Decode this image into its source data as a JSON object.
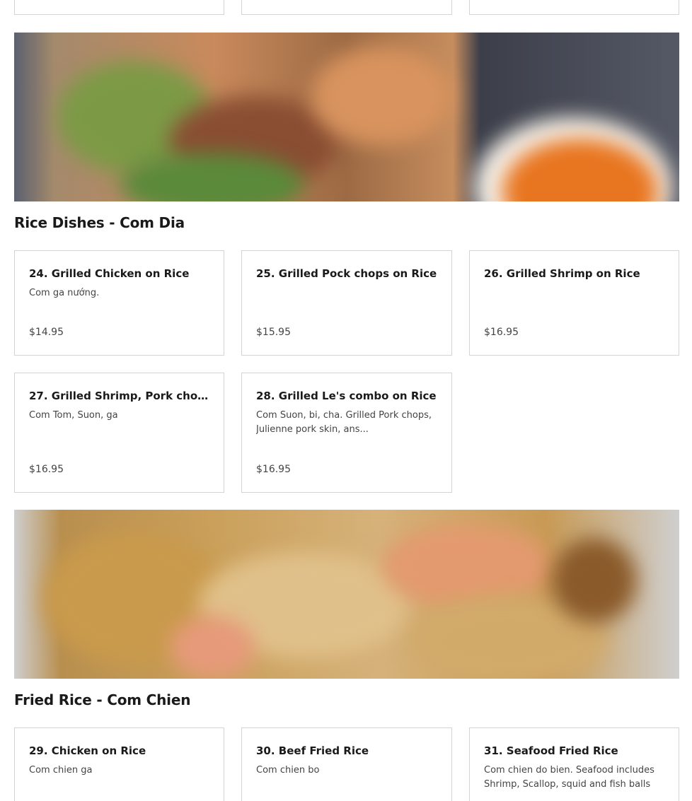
{
  "sections": [
    {
      "title": "Rice Dishes - Com Dia",
      "items": [
        {
          "name": "24. Grilled Chicken on Rice",
          "description": "Com ga nướng.",
          "price": "$14.95"
        },
        {
          "name": "25. Grilled Pock chops on Rice",
          "description": "",
          "price": "$15.95"
        },
        {
          "name": "26. Grilled Shrimp on Rice",
          "description": "",
          "price": "$16.95"
        },
        {
          "name": "27. Grilled Shrimp, Pork chops ...",
          "description": "Com Tom, Suon, ga",
          "price": "$16.95"
        },
        {
          "name": "28. Grilled Le's combo on Rice",
          "description": "Com Suon, bi, cha. Grilled Pork chops, Julienne pork skin, ans...",
          "price": "$16.95"
        }
      ]
    },
    {
      "title": "Fried Rice - Com Chien",
      "items": [
        {
          "name": "29. Chicken on Rice",
          "description": "Com chien ga",
          "price": ""
        },
        {
          "name": "30. Beef Fried Rice",
          "description": "Com chien bo",
          "price": ""
        },
        {
          "name": "31. Seafood Fried Rice",
          "description": "Com chien do bien. Seafood includes Shrimp, Scallop, squid and fish balls",
          "price": ""
        }
      ]
    }
  ]
}
